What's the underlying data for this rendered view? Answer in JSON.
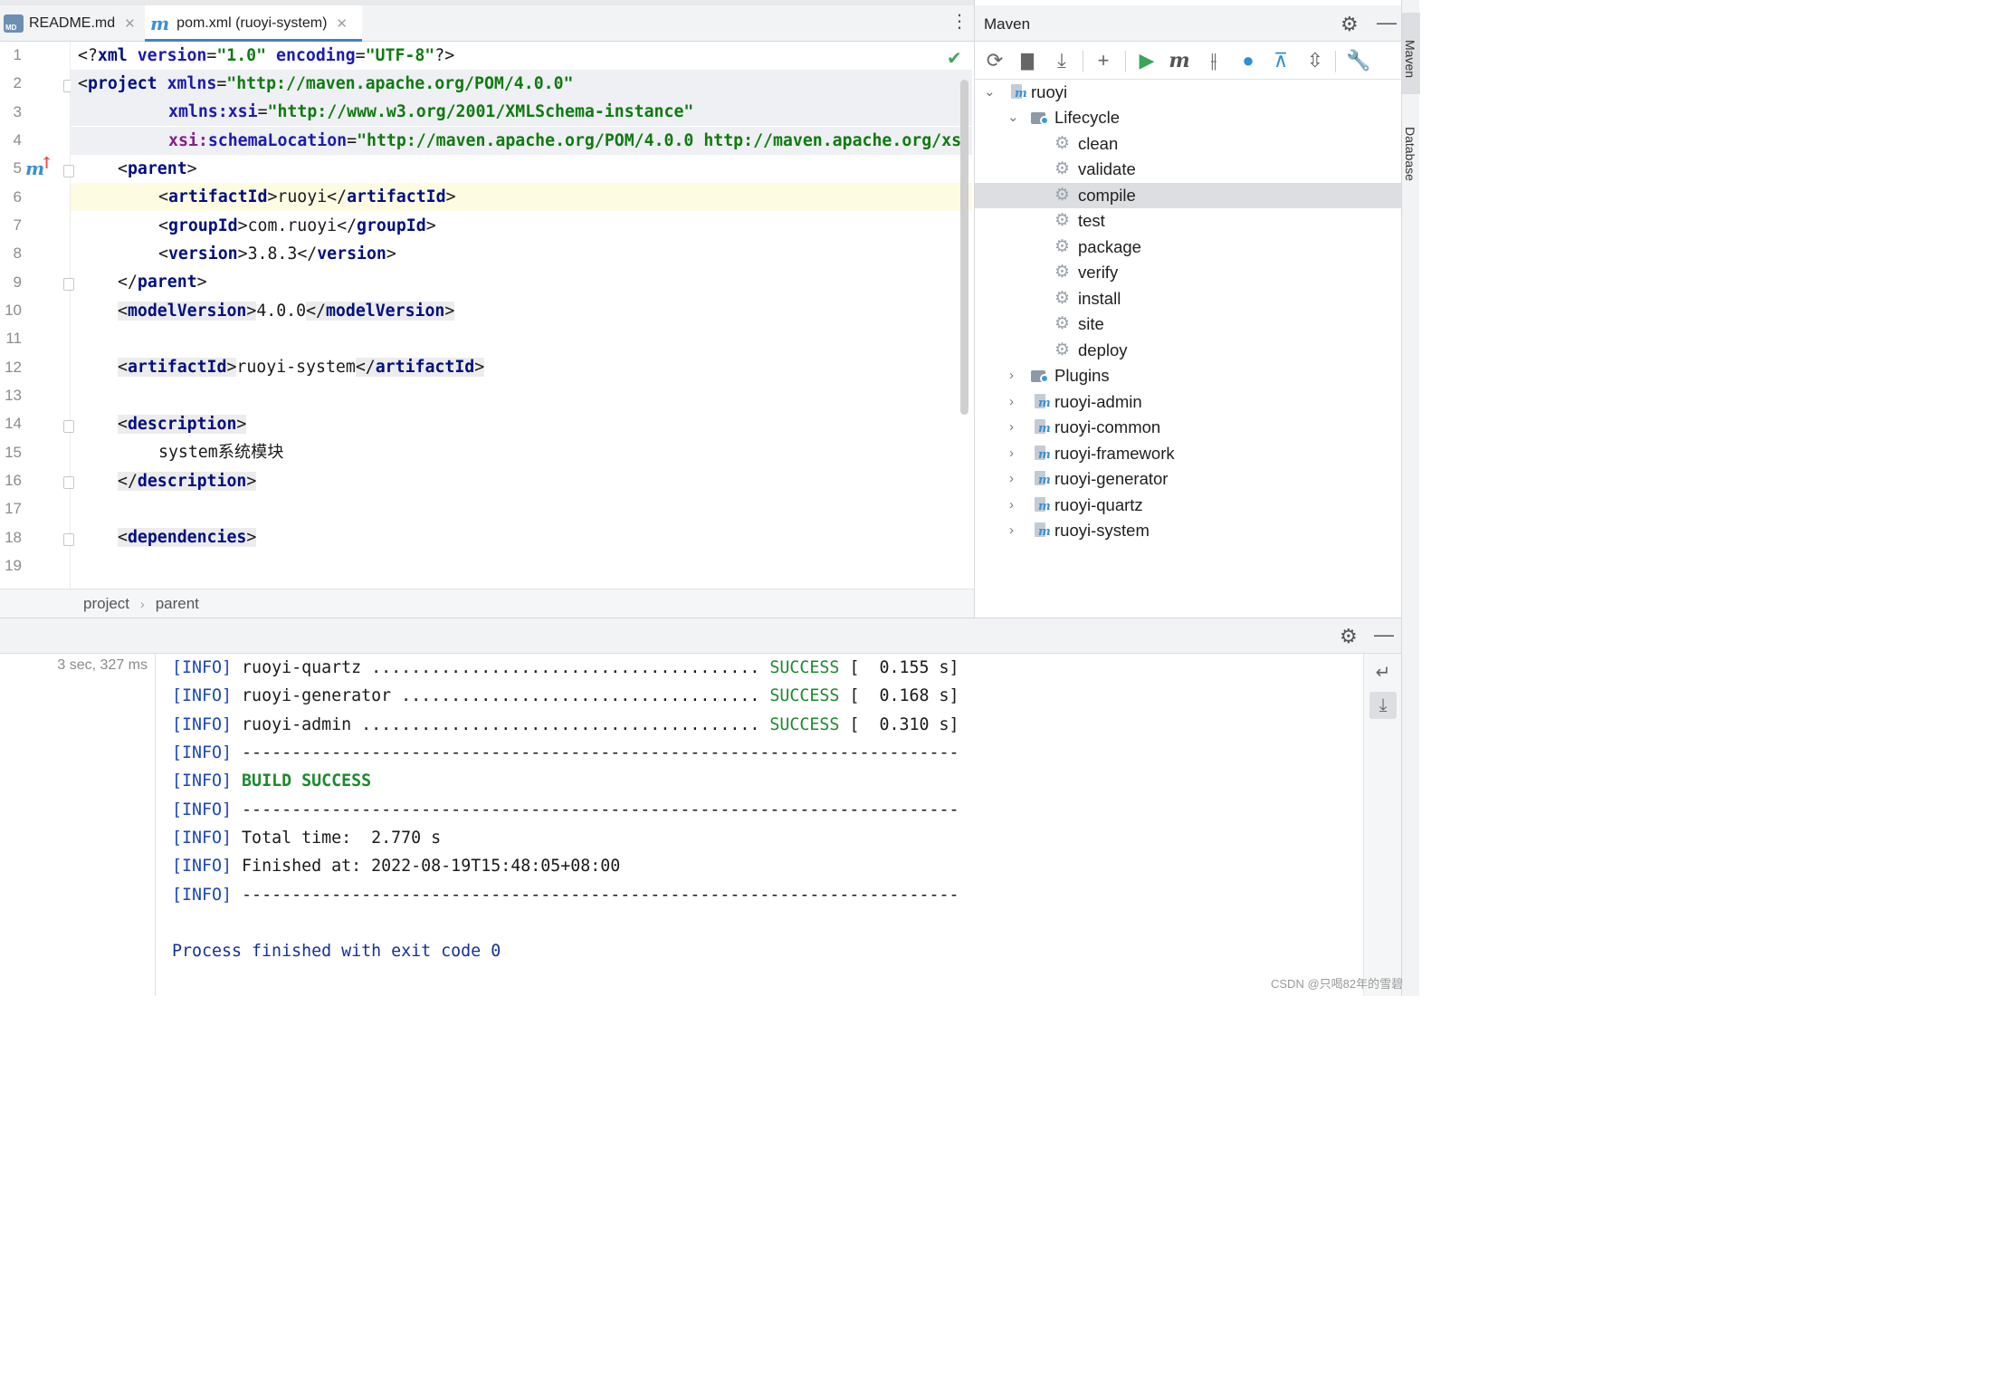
{
  "tabs": [
    {
      "label": "README.md",
      "icon": "markdown-file-icon",
      "active": false
    },
    {
      "label": "pom.xml (ruoyi-system)",
      "icon": "maven-file-icon",
      "active": true
    }
  ],
  "editor": {
    "line_numbers": [
      "1",
      "2",
      "3",
      "4",
      "5",
      "6",
      "7",
      "8",
      "9",
      "10",
      "11",
      "12",
      "13",
      "14",
      "15",
      "16",
      "17",
      "18",
      "19"
    ],
    "lines": {
      "l1": {
        "a": "<?",
        "b": "xml ",
        "c": "version",
        "d": "=",
        "e": "\"1.0\"",
        "f": " encoding",
        "g": "=",
        "h": "\"UTF-8\"",
        "i": "?>"
      },
      "l2": {
        "a": "<",
        "b": "project ",
        "c": "xmlns",
        "d": "=",
        "e": "\"http://maven.apache.org/POM/4.0.0\""
      },
      "l3": {
        "a": "xmlns:",
        "b": "xsi",
        "c": "=",
        "d": "\"http://www.w3.org/2001/XMLSchema-instance\""
      },
      "l4": {
        "a": "xsi:",
        "b": "schemaLocation",
        "c": "=",
        "d": "\"http://maven.apache.org/POM/4.0.0 http://maven.apache.org/xs"
      },
      "l5": {
        "a": "<",
        "b": "parent",
        "c": ">"
      },
      "l6": {
        "a": "<",
        "b": "artifactId",
        "c": ">",
        "d": "ruoyi",
        "e": "</",
        "f": "artifactId",
        "g": ">"
      },
      "l7": {
        "a": "<",
        "b": "groupId",
        "c": ">",
        "d": "com.ruoyi",
        "e": "</",
        "f": "groupId",
        "g": ">"
      },
      "l8": {
        "a": "<",
        "b": "version",
        "c": ">",
        "d": "3.8.3",
        "e": "</",
        "f": "version",
        "g": ">"
      },
      "l9": {
        "a": "</",
        "b": "parent",
        "c": ">"
      },
      "l10": {
        "a": "<",
        "b": "modelVersion",
        "c": ">",
        "d": "4.0.0",
        "e": "</",
        "f": "modelVersion",
        "g": ">"
      },
      "l12": {
        "a": "<",
        "b": "artifactId",
        "c": ">",
        "d": "ruoyi-system",
        "e": "</",
        "f": "artifactId",
        "g": ">"
      },
      "l14": {
        "a": "<",
        "b": "description",
        "c": ">"
      },
      "l15": {
        "a": "system系统模块"
      },
      "l16": {
        "a": "</",
        "b": "description",
        "c": ">"
      },
      "l18": {
        "a": "<",
        "b": "dependencies",
        "c": ">"
      }
    }
  },
  "breadcrumb": [
    "project",
    "parent"
  ],
  "maven": {
    "title": "Maven",
    "toolbar_icons": [
      "reload-icon",
      "generate-sources-icon",
      "download-icon",
      "add-icon",
      "run-icon",
      "execute-goal-icon",
      "toggle-offline-icon",
      "skip-tests-icon",
      "show-dependencies-icon",
      "collapse-all-icon",
      "settings-wrench-icon"
    ],
    "root": "ruoyi",
    "lifecycle_label": "Lifecycle",
    "goals": [
      "clean",
      "validate",
      "compile",
      "test",
      "package",
      "verify",
      "install",
      "site",
      "deploy"
    ],
    "selected_goal": "compile",
    "plugins_label": "Plugins",
    "modules": [
      "ruoyi-admin",
      "ruoyi-common",
      "ruoyi-framework",
      "ruoyi-generator",
      "ruoyi-quartz",
      "ruoyi-system"
    ]
  },
  "sidebar_right": {
    "maven": "Maven",
    "database": "Database"
  },
  "console": {
    "time": "3 sec, 327 ms",
    "info_tag": "[INFO]",
    "rows": [
      {
        "text": " ruoyi-quartz ....................................... ",
        "status": "SUCCESS",
        "timing": " [  0.155 s]"
      },
      {
        "text": " ruoyi-generator .................................... ",
        "status": "SUCCESS",
        "timing": " [  0.168 s]"
      },
      {
        "text": " ruoyi-admin ........................................ ",
        "status": "SUCCESS",
        "timing": " [  0.310 s]"
      }
    ],
    "rule": " ------------------------------------------------------------------------",
    "build": " BUILD SUCCESS",
    "total_time": " Total time:  2.770 s",
    "finished_at": " Finished at: 2022-08-19T15:48:05+08:00",
    "process": "Process finished with exit code 0"
  },
  "watermark": "CSDN @只喝82年的雪碧",
  "colors": {
    "accent": "#4083c9",
    "success": "#1c8a2c",
    "info": "#1a47b8",
    "xml_tag": "#000f80",
    "xml_string": "#107a10"
  }
}
